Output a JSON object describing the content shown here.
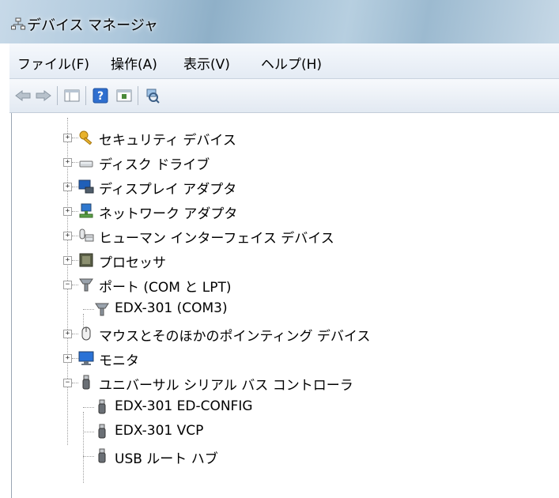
{
  "window": {
    "title": "デバイス マネージャ"
  },
  "menu": [
    {
      "label": "ファイル(F)"
    },
    {
      "label": "操作(A)"
    },
    {
      "label": "表示(V)"
    },
    {
      "label": "ヘルプ(H)"
    }
  ],
  "toolbar": {
    "back_icon": "back-arrow-icon",
    "forward_icon": "forward-arrow-icon",
    "properties_icon": "properties-icon",
    "help_icon": "help-icon",
    "console_icon": "console-tree-icon",
    "scan_icon": "scan-hardware-icon"
  },
  "tree": [
    {
      "label": "セキュリティ デバイス",
      "icon": "key-icon",
      "expanded": false
    },
    {
      "label": "ディスク ドライブ",
      "icon": "disk-drive-icon",
      "expanded": false
    },
    {
      "label": "ディスプレイ アダプタ",
      "icon": "display-adapter-icon",
      "expanded": false
    },
    {
      "label": "ネットワーク アダプタ",
      "icon": "network-adapter-icon",
      "expanded": false
    },
    {
      "label": "ヒューマン インターフェイス デバイス",
      "icon": "hid-icon",
      "expanded": false
    },
    {
      "label": "プロセッサ",
      "icon": "processor-icon",
      "expanded": false
    },
    {
      "label": "ポート (COM と LPT)",
      "icon": "port-icon",
      "expanded": true
    },
    {
      "label": "EDX-301 (COM3)",
      "icon": "port-icon",
      "child": true
    },
    {
      "label": "マウスとそのほかのポインティング デバイス",
      "icon": "mouse-icon",
      "expanded": false
    },
    {
      "label": "モニタ",
      "icon": "monitor-icon",
      "expanded": false
    },
    {
      "label": "ユニバーサル シリアル バス コントローラ",
      "icon": "usb-icon",
      "expanded": true
    },
    {
      "label": "EDX-301 ED-CONFIG",
      "icon": "usb-icon",
      "child": true
    },
    {
      "label": "EDX-301 VCP",
      "icon": "usb-icon",
      "child": true
    },
    {
      "label": "USB ルート ハブ",
      "icon": "usb-icon",
      "child": true
    }
  ]
}
